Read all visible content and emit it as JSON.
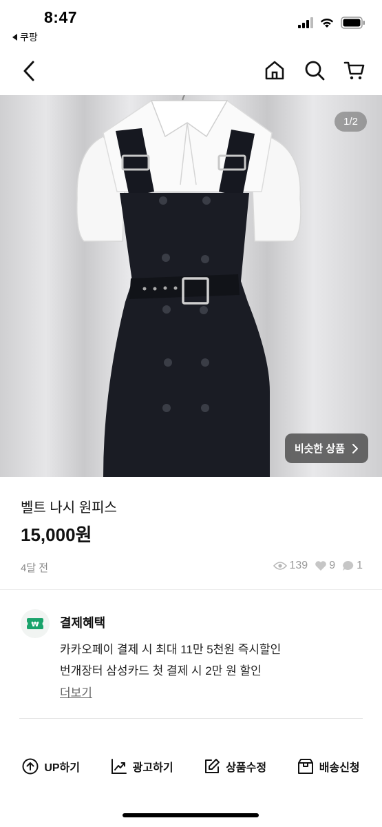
{
  "status_bar": {
    "time": "8:47",
    "back_app": "쿠팡",
    "icons": [
      "signal-icon",
      "wifi-icon",
      "battery-icon"
    ]
  },
  "nav": {
    "icons": [
      "back-icon",
      "home-icon",
      "search-icon",
      "cart-icon"
    ]
  },
  "gallery": {
    "counter": "1/2",
    "similar_button": "비슷한 상품"
  },
  "product": {
    "title": "벨트 나시 원피스",
    "price": "15,000원",
    "posted": "4달 전",
    "views": "139",
    "likes": "9",
    "chats": "1"
  },
  "benefits": {
    "title": "결제혜택",
    "line1": "카카오페이 결제 시 최대 11만 5천원 즉시할인",
    "line2": "번개장터 삼성카드 첫 결제 시 2만 원  할인",
    "more": "더보기",
    "icon_color": "#1aa36b"
  },
  "actions": [
    {
      "label": "UP하기",
      "icon": "up-arrow-circle-icon"
    },
    {
      "label": "광고하기",
      "icon": "chart-trend-icon"
    },
    {
      "label": "상품수정",
      "icon": "edit-icon"
    },
    {
      "label": "배송신청",
      "icon": "box-icon"
    }
  ]
}
